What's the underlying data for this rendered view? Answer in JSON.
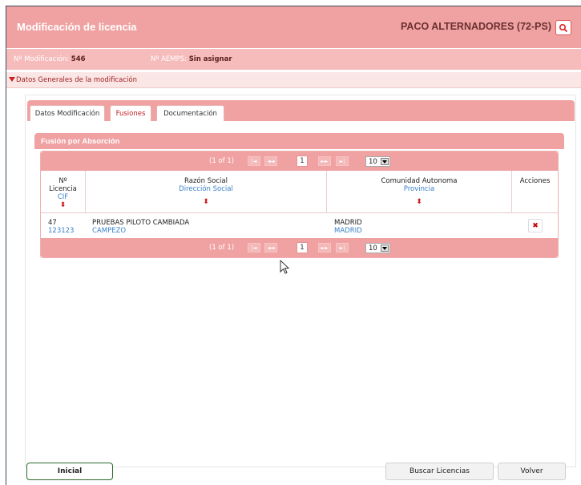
{
  "header": {
    "title": "Modificación de licencia",
    "company": "PACO ALTERNADORES (72-PS)",
    "search_icon": "search-icon"
  },
  "info": {
    "mod_label": "Nº Modificación:",
    "mod_value": "546",
    "aemps_label": "Nº AEMPS:",
    "aemps_value": "Sin asignar"
  },
  "section": {
    "label": "Datos Generales de la modificación"
  },
  "tabs": [
    {
      "label": "Datos Modificación"
    },
    {
      "label": "Fusiones"
    },
    {
      "label": "Documentación"
    }
  ],
  "subtitle": "Fusión por Absorción",
  "pager": {
    "text": "(1 of 1)",
    "first": "|◄",
    "prev": "◄◄",
    "page": "1",
    "next": "►►",
    "last": "►|",
    "size": "10"
  },
  "table": {
    "columns": [
      {
        "label": "Nº",
        "label2": "Licencia",
        "sub": "CIF"
      },
      {
        "label": "Razón Social",
        "sub": "Dirección Social"
      },
      {
        "label": "Comunidad Autonoma",
        "sub": "Provincia"
      },
      {
        "label": "Acciones"
      }
    ],
    "rows": [
      {
        "licencia": "47",
        "cif": "123123",
        "razon": "PRUEBAS PILOTO CAMBIADA",
        "direccion": "CAMPEZO",
        "comunidad": "MADRID",
        "provincia": "MADRID"
      }
    ]
  },
  "footer": {
    "inicial": "Inicial",
    "buscar": "Buscar Licencias",
    "volver": "Volver"
  }
}
